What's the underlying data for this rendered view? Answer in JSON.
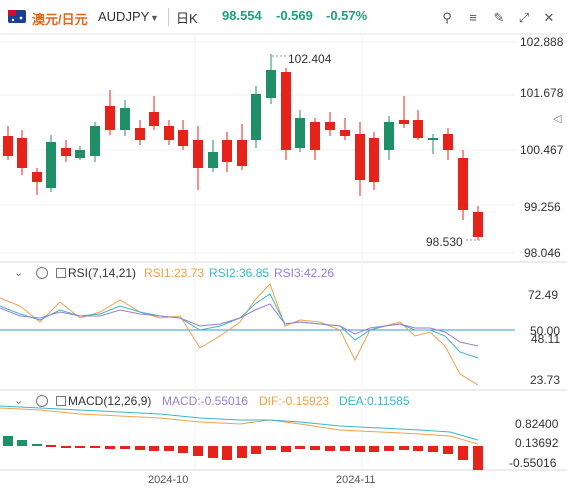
{
  "header": {
    "pair_name": "澳元/日元",
    "pair_code": "AUDJPY",
    "period": "日K",
    "price": "98.554",
    "change": "-0.569",
    "change_pct": "-0.57%",
    "icons": [
      "currency-flag-icon",
      "indicator-icon",
      "draw-icon",
      "brush-icon",
      "fullscreen-icon",
      "close-icon"
    ]
  },
  "main_axis": {
    "ticks": [
      "102.888",
      "101.678",
      "100.467",
      "99.256",
      "98.046"
    ],
    "high_label": "102.404",
    "low_label": "98.530"
  },
  "rsi": {
    "title": "RSI(7,14,21)",
    "rsi1": "RSI1:23.73",
    "rsi2": "RSI2:36.85",
    "rsi3": "RSI3:42.26",
    "ticks": [
      "72.49",
      "50.00",
      "48.11",
      "23.73"
    ]
  },
  "macd": {
    "title": "MACD(12,26,9)",
    "macd": "MACD:-0.55016",
    "dif": "DIF:-0.15923",
    "dea": "DEA:0.11585",
    "ticks": [
      "0.82400",
      "0.13692",
      "-0.55016"
    ]
  },
  "x_axis": {
    "ticks": [
      "2024-10",
      "2024-11"
    ]
  },
  "colors": {
    "up": "#1f8f67",
    "down": "#e5231b",
    "rsi1": "#f0a14a",
    "rsi2": "#3bb6c9",
    "rsi3": "#9a7fd1",
    "accent": "#e8641b",
    "positive": "#1aa37a"
  }
}
